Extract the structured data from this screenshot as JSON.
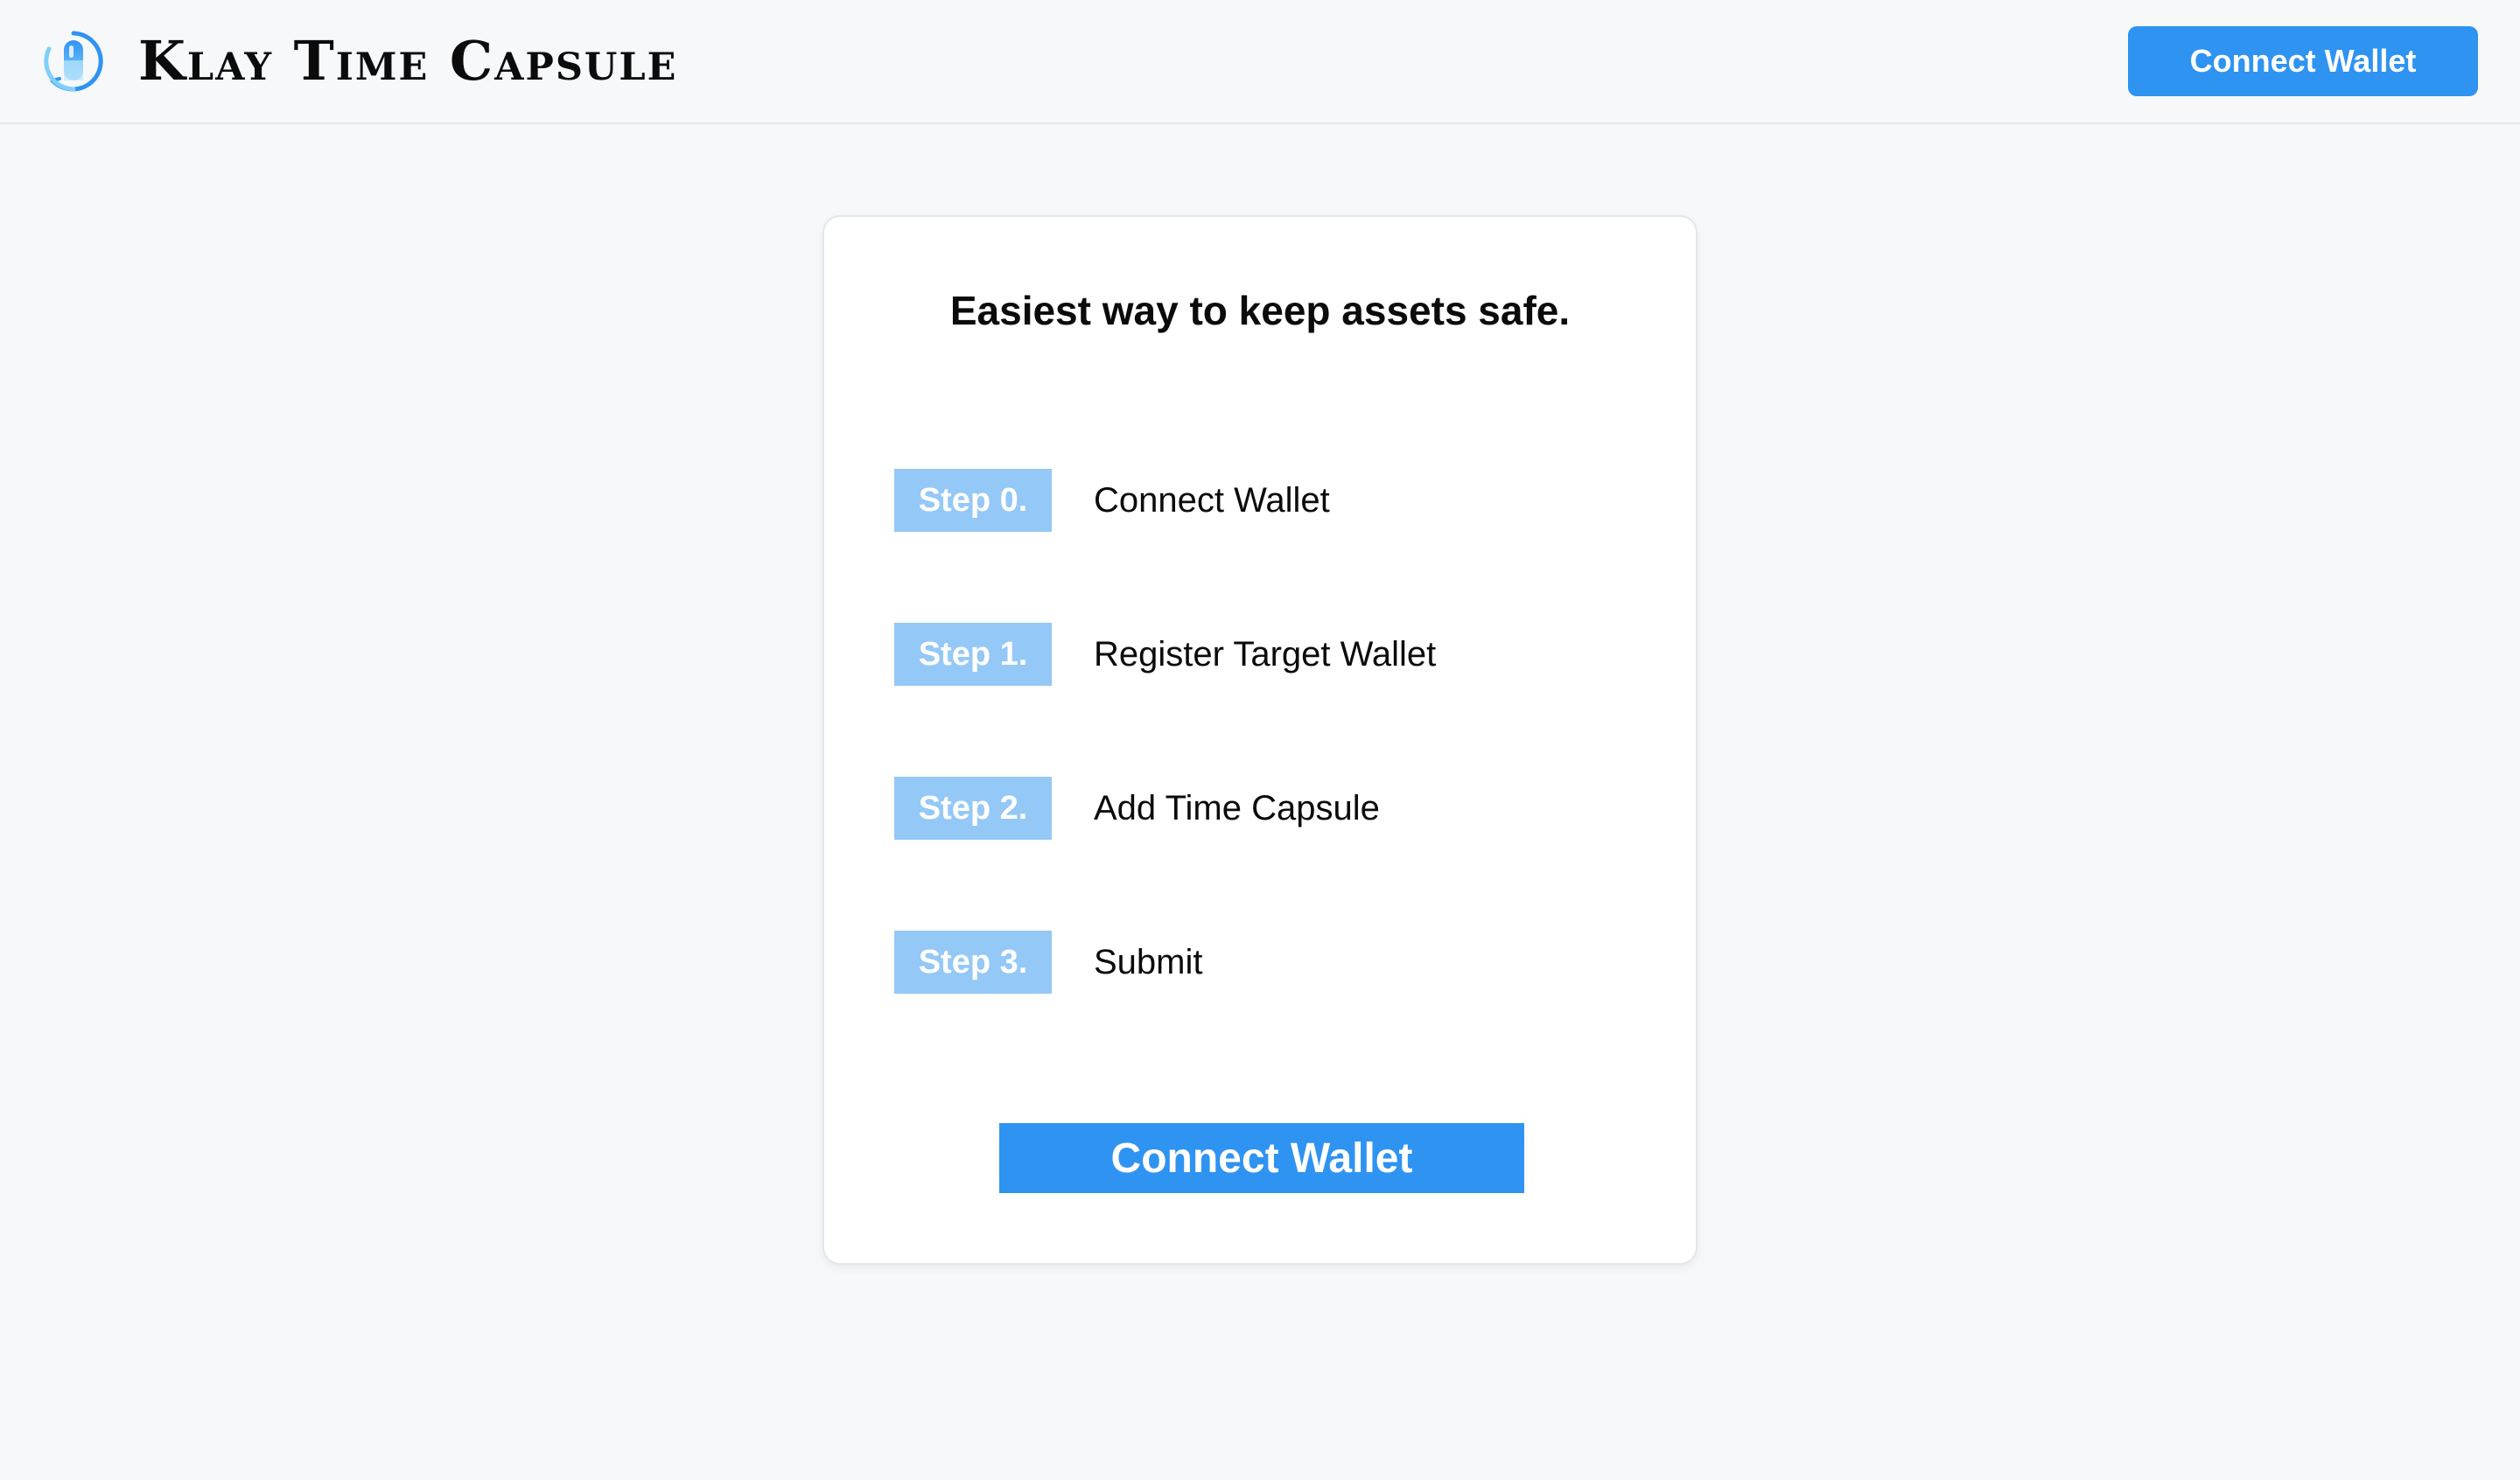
{
  "header": {
    "brand": "Klay Time Capsule",
    "logo_icon": "capsule-logo-icon",
    "connect_label": "Connect Wallet"
  },
  "card": {
    "title": "Easiest way to keep assets safe.",
    "steps": [
      {
        "badge": "Step 0.",
        "label": "Connect Wallet"
      },
      {
        "badge": "Step 1.",
        "label": "Register Target Wallet"
      },
      {
        "badge": "Step 2.",
        "label": "Add Time Capsule"
      },
      {
        "badge": "Step 3.",
        "label": "Submit"
      }
    ],
    "connect_label": "Connect Wallet"
  },
  "colors": {
    "accent": "#2f93f2",
    "badge": "#94c8f6",
    "background": "#f7f8fa"
  }
}
